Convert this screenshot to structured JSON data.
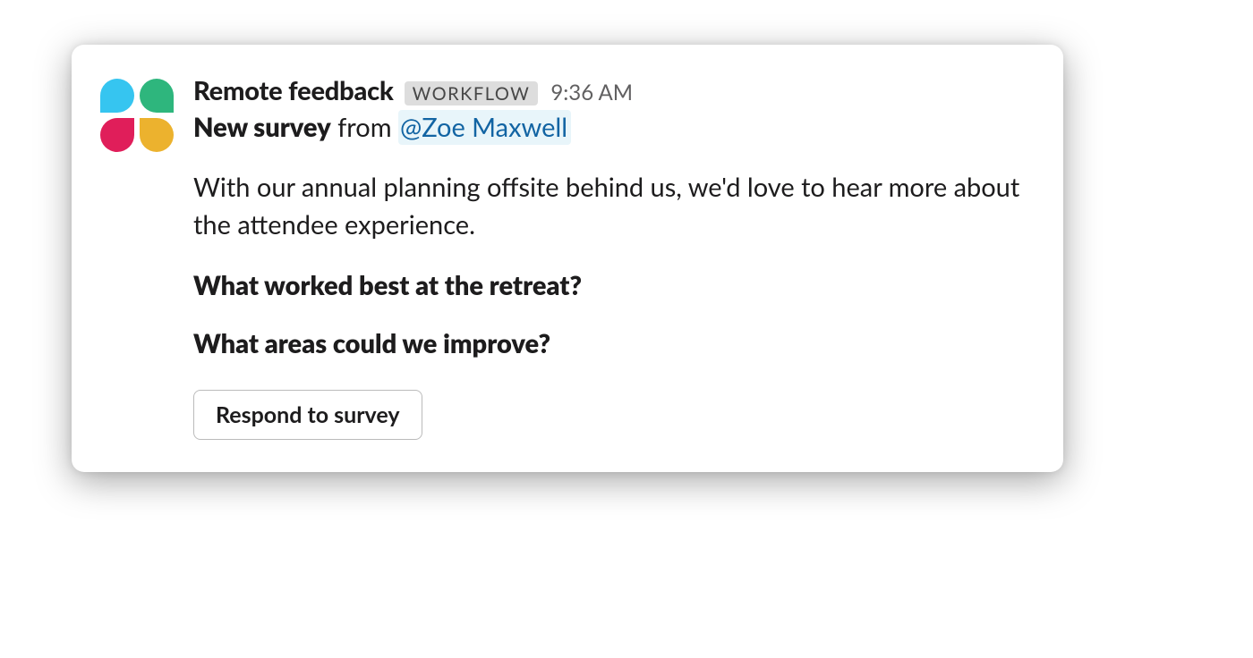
{
  "message": {
    "sender_name": "Remote feedback",
    "badge_label": "WORKFLOW",
    "timestamp": "9:36 AM",
    "subject_bold": "New survey",
    "subject_from": "from",
    "subject_mention": "@Zoe Maxwell",
    "body": "With our annual planning offsite behind us, we'd love to hear more about the attendee experience.",
    "question1": "What worked best at the retreat?",
    "question2": "What areas could we improve?",
    "button_label": "Respond to survey"
  }
}
